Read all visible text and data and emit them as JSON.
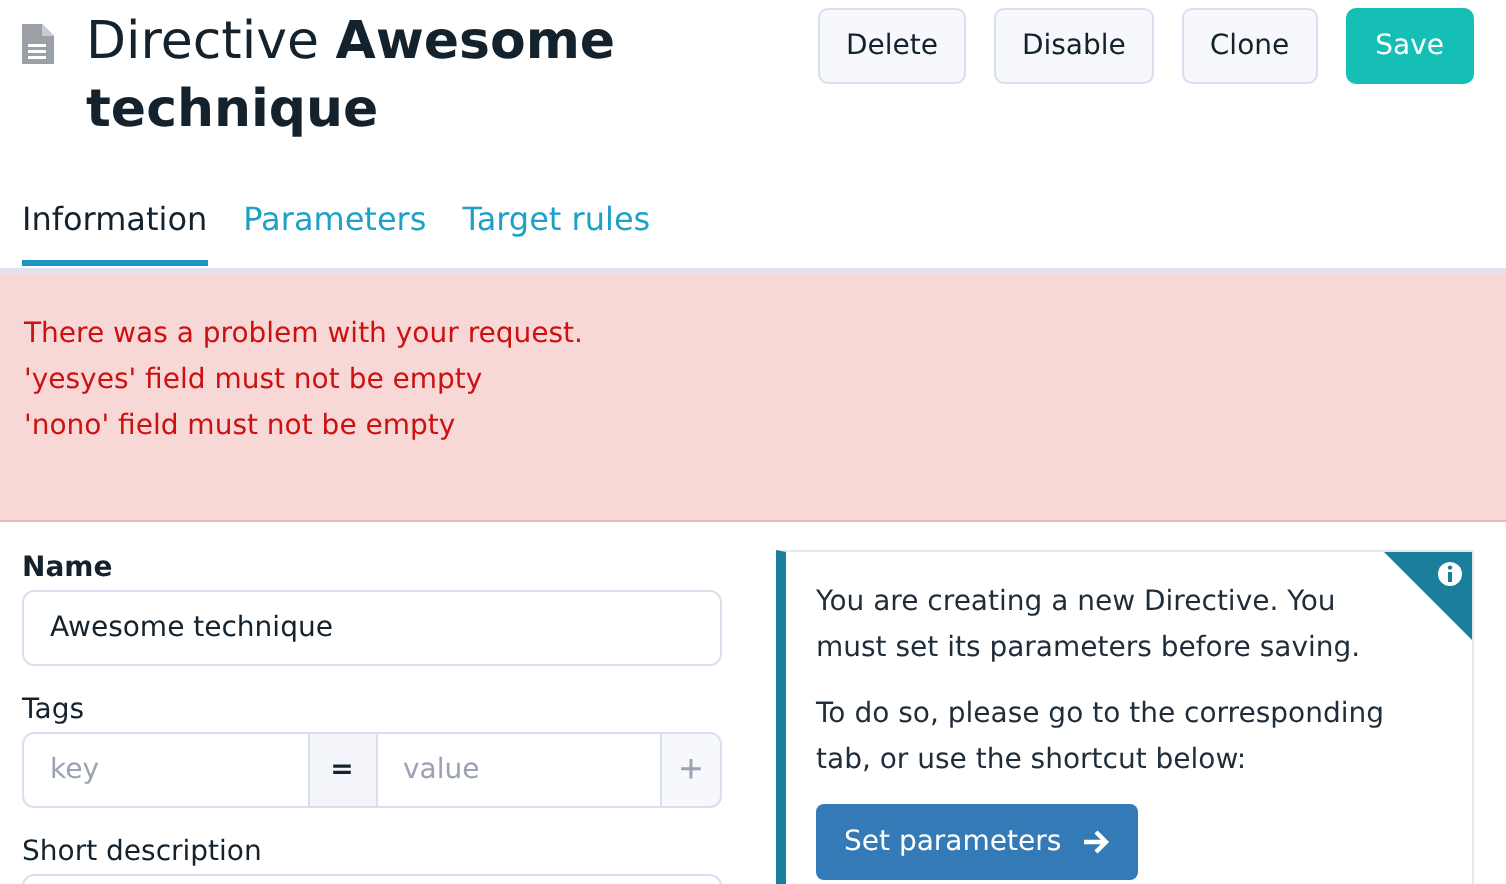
{
  "header": {
    "title": "Directive **Awesome technique**"
  },
  "buttons": [
    {
      "label": "Delete",
      "kind": "default"
    },
    {
      "label": "Disable",
      "kind": "default"
    },
    {
      "label": "Clone",
      "kind": "default"
    },
    {
      "label": "Save",
      "kind": "primary"
    }
  ],
  "tabs": [
    {
      "label": "Information",
      "selected": true
    },
    {
      "label": "Parameters",
      "selected": false
    },
    {
      "label": "Target rules",
      "selected": false
    }
  ],
  "error": {
    "lines": [
      "There was a problem with your request.",
      "'yesyes' field must not be empty",
      "'nono' field must not be empty"
    ]
  },
  "form": {
    "name": {
      "label": "Name",
      "value": "Awesome technique"
    },
    "tags": {
      "label": "Tags",
      "key_placeholder": "key",
      "separator": "=",
      "value_placeholder": "value",
      "add": "+"
    },
    "short_description": {
      "label": "Short description"
    }
  },
  "info_card": {
    "paragraphs": [
      "You are creating a new Directive. You must set its parameters before saving.",
      "To do so, please go to the corresponding tab, or use the shortcut below:"
    ],
    "button": "Set parameters"
  }
}
